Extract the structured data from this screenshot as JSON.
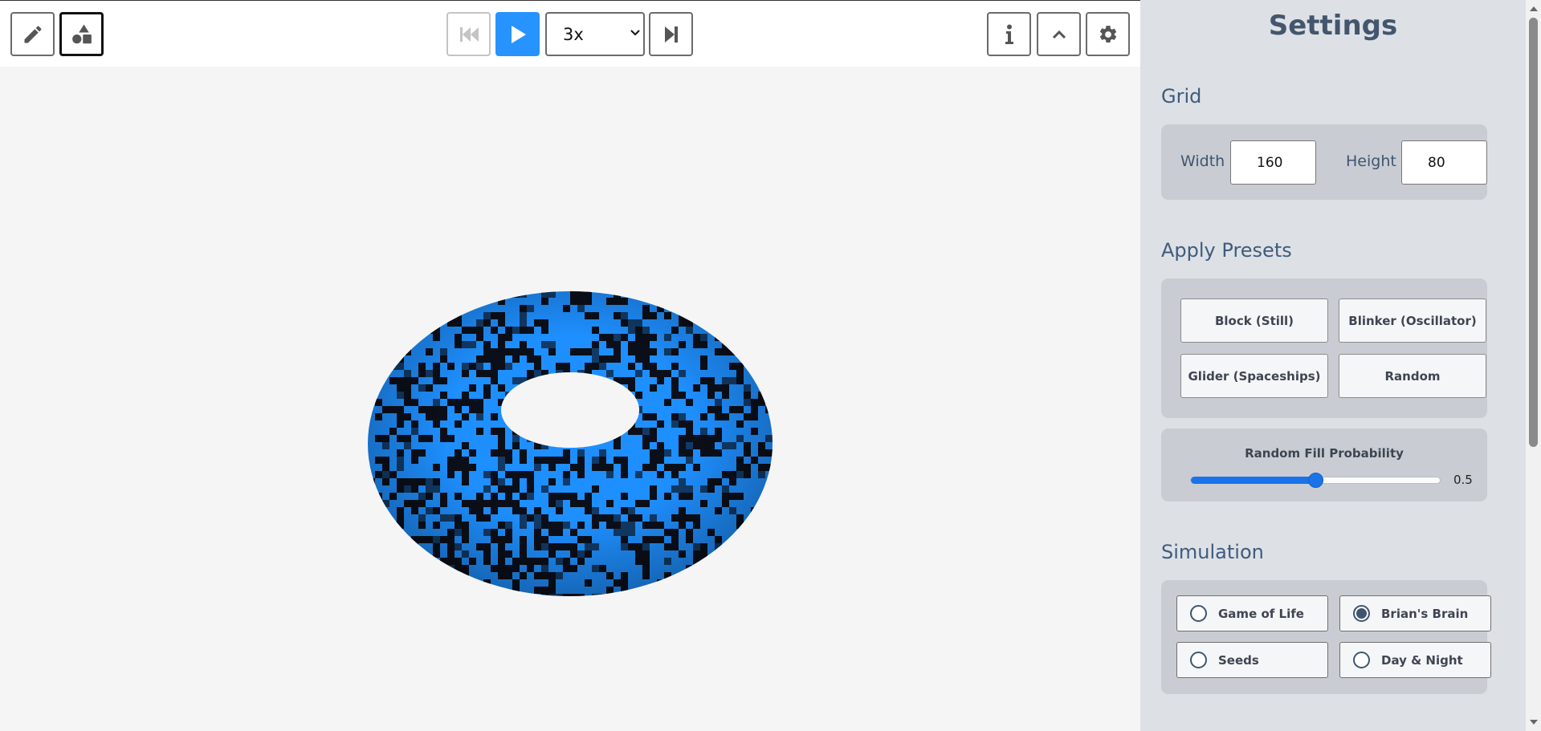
{
  "toolbar": {
    "draw_tool": {
      "icon": "pencil-icon"
    },
    "shapes_tool": {
      "icon": "shapes-icon"
    },
    "reset_button": {
      "icon": "skip-to-start-icon"
    },
    "play_button": {
      "icon": "play-icon"
    },
    "speed": {
      "selected": "3x"
    },
    "step_button": {
      "icon": "step-forward-icon"
    },
    "info_button": {
      "icon": "info-icon"
    },
    "collapse_button": {
      "icon": "chevron-up-icon"
    },
    "settings_button": {
      "icon": "gear-icon"
    }
  },
  "canvas": {
    "description_colors": {
      "alive": "#1e8fff",
      "dead": "#0b0f19",
      "background": "#f5f5f5"
    }
  },
  "settings": {
    "title": "Settings",
    "grid": {
      "title": "Grid",
      "width_label": "Width",
      "width_value": "160",
      "height_label": "Height",
      "height_value": "80"
    },
    "presets": {
      "title": "Apply Presets",
      "buttons": [
        "Block (Still)",
        "Blinker (Oscillator)",
        "Glider (Spaceships)",
        "Random"
      ],
      "fill_probability": {
        "label": "Random Fill Probability",
        "value": 0.5,
        "value_text": "0.5",
        "min": 0,
        "max": 1
      }
    },
    "simulation": {
      "title": "Simulation",
      "options": [
        {
          "label": "Game of Life",
          "selected": false
        },
        {
          "label": "Brian's Brain",
          "selected": true
        },
        {
          "label": "Seeds",
          "selected": false
        },
        {
          "label": "Day & Night",
          "selected": false
        }
      ]
    }
  },
  "colors": {
    "accent": "#2793ff",
    "panel_bg": "#dde1e6",
    "card_bg": "#c9cdd3",
    "heading": "#43566d"
  }
}
